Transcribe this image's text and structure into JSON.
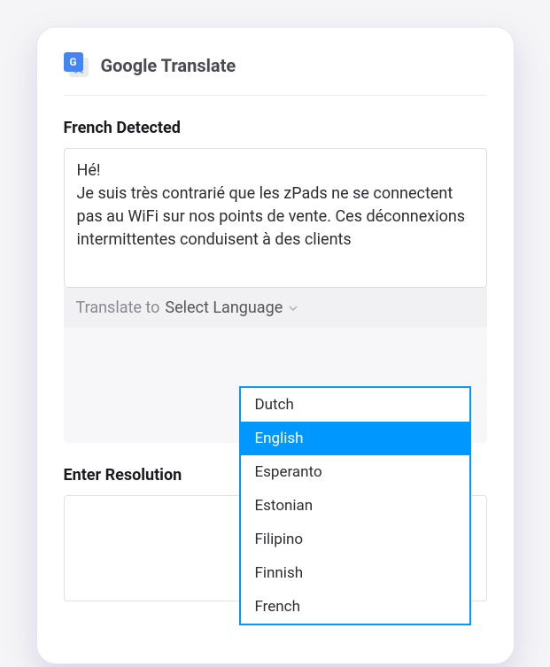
{
  "header": {
    "title": "Google Translate",
    "icon_letter": "G"
  },
  "detected": {
    "label": "French Detected",
    "source_text": "Hé!\nJe suis très contrarié que les zPads ne se connectent pas au WiFi sur nos points de vente. Ces déconnexions intermittentes conduisent à des clients"
  },
  "translate_bar": {
    "label": "Translate to",
    "selected_placeholder": "Select Language"
  },
  "dropdown": {
    "options": [
      "Dutch",
      "English",
      "Esperanto",
      "Estonian",
      "Filipino",
      "Finnish",
      "French"
    ],
    "highlighted": "English"
  },
  "resolution": {
    "label": "Enter Resolution"
  }
}
